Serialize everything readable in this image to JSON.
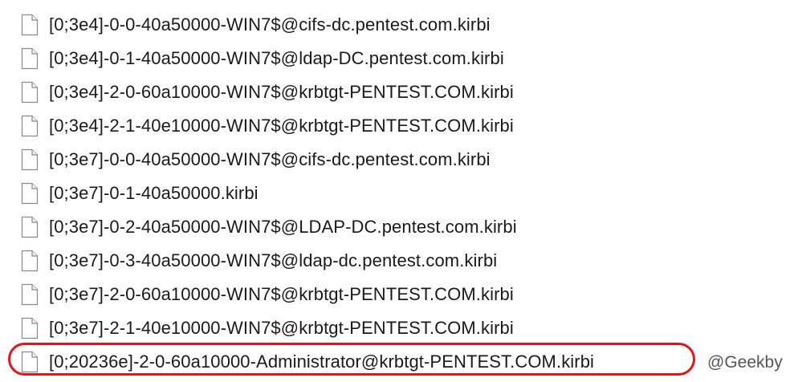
{
  "files": [
    {
      "name": "[0;3e4]-0-0-40a50000-WIN7$@cifs-dc.pentest.com.kirbi"
    },
    {
      "name": "[0;3e4]-0-1-40a50000-WIN7$@ldap-DC.pentest.com.kirbi"
    },
    {
      "name": "[0;3e4]-2-0-60a10000-WIN7$@krbtgt-PENTEST.COM.kirbi"
    },
    {
      "name": "[0;3e4]-2-1-40e10000-WIN7$@krbtgt-PENTEST.COM.kirbi"
    },
    {
      "name": "[0;3e7]-0-0-40a50000-WIN7$@cifs-dc.pentest.com.kirbi"
    },
    {
      "name": "[0;3e7]-0-1-40a50000.kirbi"
    },
    {
      "name": "[0;3e7]-0-2-40a50000-WIN7$@LDAP-DC.pentest.com.kirbi"
    },
    {
      "name": "[0;3e7]-0-3-40a50000-WIN7$@ldap-dc.pentest.com.kirbi"
    },
    {
      "name": "[0;3e7]-2-0-60a10000-WIN7$@krbtgt-PENTEST.COM.kirbi"
    },
    {
      "name": "[0;3e7]-2-1-40e10000-WIN7$@krbtgt-PENTEST.COM.kirbi"
    },
    {
      "name": "[0;20236e]-2-0-60a10000-Administrator@krbtgt-PENTEST.COM.kirbi"
    }
  ],
  "highlight": {
    "row_index": 10,
    "color": "#e3151b"
  },
  "icon": "generic-file-icon",
  "watermark": "@Geekby"
}
